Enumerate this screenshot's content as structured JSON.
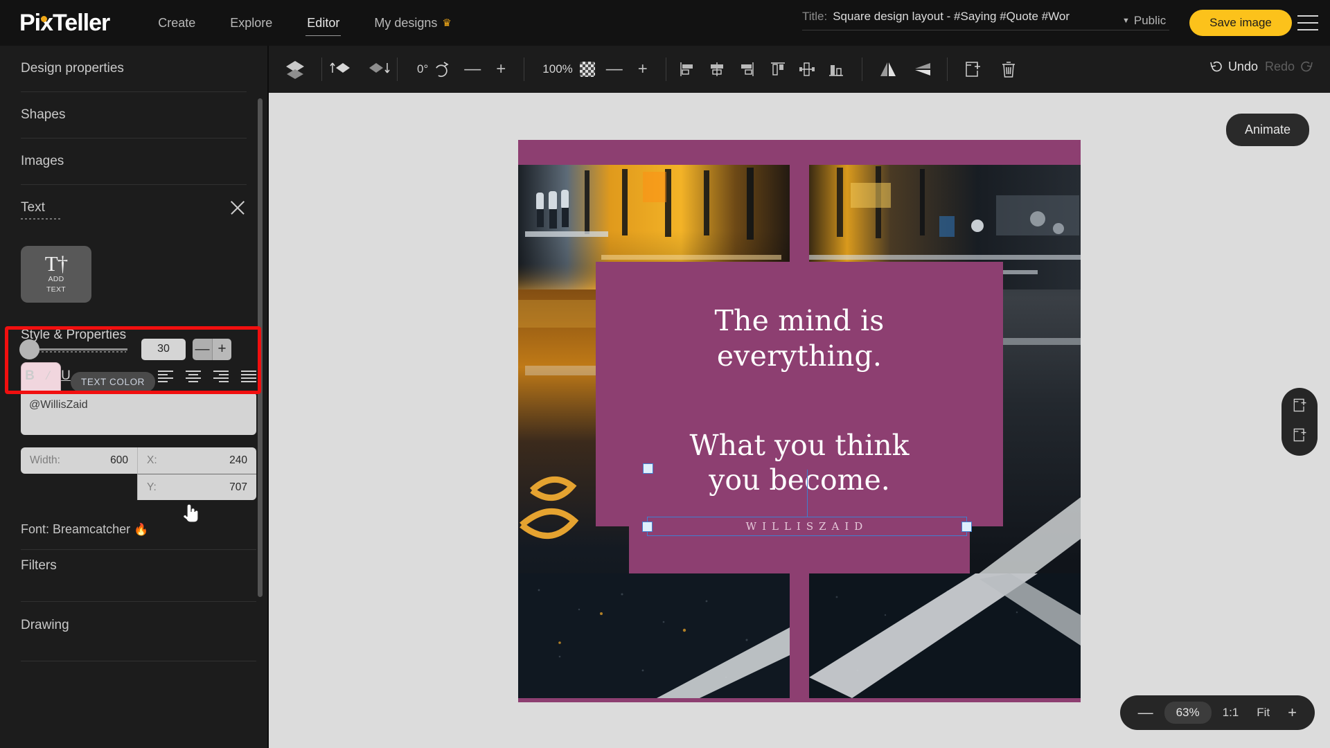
{
  "brand": {
    "name": "PixTeller"
  },
  "nav": {
    "items": [
      {
        "label": "Create",
        "active": false
      },
      {
        "label": "Explore",
        "active": false
      },
      {
        "label": "Editor",
        "active": true
      },
      {
        "label": "My designs",
        "active": false,
        "crown": "♛"
      }
    ]
  },
  "titlebar": {
    "label": "Title:",
    "value": "Square design layout - #Saying #Quote #Wor",
    "privacy": "Public",
    "privacy_caret": "▼",
    "save_label": "Save image",
    "menu_icon": "hamburger-icon"
  },
  "toolbar": {
    "layers_icon": "layers-icon",
    "bring_forward_icon": "bring-forward-icon",
    "send_backward_icon": "send-backward-icon",
    "rotation_value": "0°",
    "rotate_icon": "rotate-icon",
    "rotate_minus": "—",
    "rotate_plus": "+",
    "opacity_value": "100%",
    "opacity_icon": "transparency-checker-icon",
    "opacity_minus": "—",
    "opacity_plus": "+",
    "align_left_icon": "align-left-icon",
    "align_center_icon": "align-center-icon",
    "align_right_icon": "align-right-icon",
    "align_top_icon": "align-top-icon",
    "align_middle_icon": "align-middle-icon",
    "align_bottom_icon": "align-bottom-icon",
    "flip_horizontal_icon": "flip-horizontal-icon",
    "flip_vertical_icon": "flip-vertical-icon",
    "duplicate_icon": "duplicate-icon",
    "delete_icon": "trash-icon",
    "undo_label": "Undo",
    "redo_label": "Redo"
  },
  "sidebar": {
    "sections": [
      {
        "label": "Design properties"
      },
      {
        "label": "Shapes"
      },
      {
        "label": "Images"
      },
      {
        "label": "Text"
      }
    ],
    "text_panel": {
      "close_icon": "close-icon",
      "add_text": {
        "icon": "add-text-icon",
        "line1": "ADD",
        "line2": "TEXT"
      }
    },
    "style_section": {
      "title": "Style & Properties",
      "text_color_label": "TEXT COLOR",
      "text_color_value": "#f1d6de",
      "font_size_value": "30",
      "minus": "—",
      "plus": "+",
      "bold": "B",
      "italic": "/",
      "underline": "U",
      "text_value": "@WillisZaid",
      "width_label": "Width:",
      "width_value": "600",
      "x_label": "X:",
      "x_value": "240",
      "y_label": "Y:",
      "y_value": "707",
      "font_label": "Font:",
      "font_name": "Breamcatcher",
      "font_flame": "🔥"
    },
    "lower_sections": [
      {
        "label": "Filters"
      },
      {
        "label": "Drawing"
      }
    ],
    "highlight_color": "#f10f0f"
  },
  "canvas": {
    "background_color": "#8d3f71",
    "quote_line1": "The mind is",
    "quote_line2": "everything.",
    "quote_line3": "What you think",
    "quote_line4": "you become.",
    "author": "WILLISZAID",
    "animate_label": "Animate",
    "add_page_icon": "add-page-icon",
    "duplicate_page_icon": "duplicate-page-icon",
    "zoom": {
      "minus": "—",
      "level": "63%",
      "actual": "1:1",
      "fit": "Fit",
      "plus": "+"
    }
  }
}
